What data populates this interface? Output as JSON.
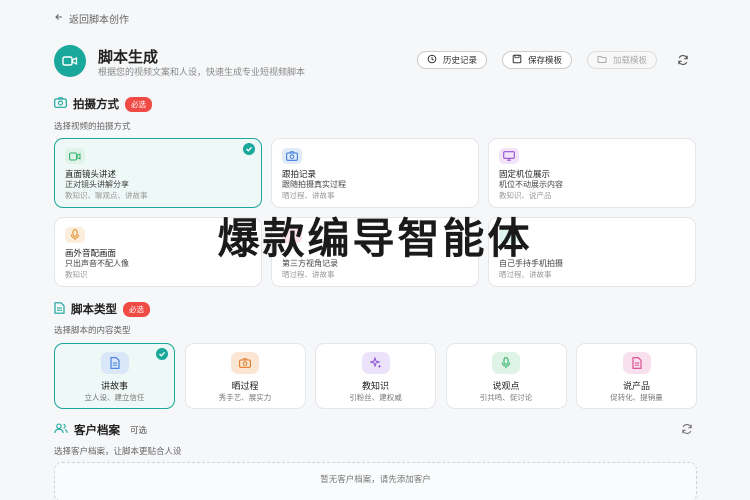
{
  "back": {
    "label": "返回脚本创作"
  },
  "header": {
    "title": "脚本生成",
    "subtitle": "根据您的视频文案和人设，快速生成专业短视频脚本"
  },
  "toolbar": {
    "history": "历史记录",
    "save_template": "保存模板",
    "load_template": "加载模板"
  },
  "shoot": {
    "title": "拍摄方式",
    "badge": "必选",
    "desc": "选择视频的拍摄方式",
    "items": [
      {
        "title": "直面镜头讲述",
        "desc": "正对镜头讲解分享",
        "tags": "教知识、聊观点、讲故事",
        "icon": "video-icon",
        "color": "#2fb36a",
        "bg": "#dff3e8",
        "selected": true
      },
      {
        "title": "跟拍记录",
        "desc": "跟随拍摄真实过程",
        "tags": "晒过程、讲故事",
        "icon": "camera-icon",
        "color": "#3d7bd9",
        "bg": "#e0ebf9",
        "selected": false
      },
      {
        "title": "固定机位展示",
        "desc": "机位不动展示内容",
        "tags": "教知识、说产品",
        "icon": "monitor-icon",
        "color": "#9b4fd0",
        "bg": "#f1e4f9",
        "selected": false
      },
      {
        "title": "画外音配画面",
        "desc": "只出声音不配人像",
        "tags": "教知识",
        "icon": "mic-icon",
        "color": "#e0902a",
        "bg": "#fbeedc",
        "selected": false
      },
      {
        "title": "",
        "desc": "第三方视角记录",
        "tags": "晒过程、讲故事",
        "icon": "",
        "color": "#e04a78",
        "bg": "#fbe1ea",
        "selected": false
      },
      {
        "title": "",
        "desc": "自己手持手机拍摄",
        "tags": "晒过程、讲故事",
        "icon": "",
        "color": "#1aa79c",
        "bg": "#dcf3f0",
        "selected": false
      }
    ]
  },
  "script_type": {
    "title": "脚本类型",
    "badge": "必选",
    "desc": "选择脚本的内容类型",
    "items": [
      {
        "title": "讲故事",
        "desc": "立人设、建立信任",
        "icon": "document-icon",
        "color": "#3d7bd9",
        "bg": "#d9e7f8",
        "selected": true
      },
      {
        "title": "晒过程",
        "desc": "秀手艺、展实力",
        "icon": "camera-icon",
        "color": "#e07a2a",
        "bg": "#fbe6d3",
        "selected": false
      },
      {
        "title": "教知识",
        "desc": "引粉丝、建权威",
        "icon": "sparkle-icon",
        "color": "#8a4fd0",
        "bg": "#ece2f9",
        "selected": false
      },
      {
        "title": "说观点",
        "desc": "引共鸣、促讨论",
        "icon": "mic-icon",
        "color": "#2fb36a",
        "bg": "#dff3e6",
        "selected": false
      },
      {
        "title": "说产品",
        "desc": "促转化、提销量",
        "icon": "document-icon",
        "color": "#d9468a",
        "bg": "#f9e0ee",
        "selected": false
      }
    ]
  },
  "customer": {
    "title": "客户档案",
    "optional": "可选",
    "desc": "选择客户档案，让脚本更贴合人设",
    "empty": "暂无客户档案，请先添加客户"
  },
  "overlay": {
    "text": "爆款编导智能体"
  }
}
